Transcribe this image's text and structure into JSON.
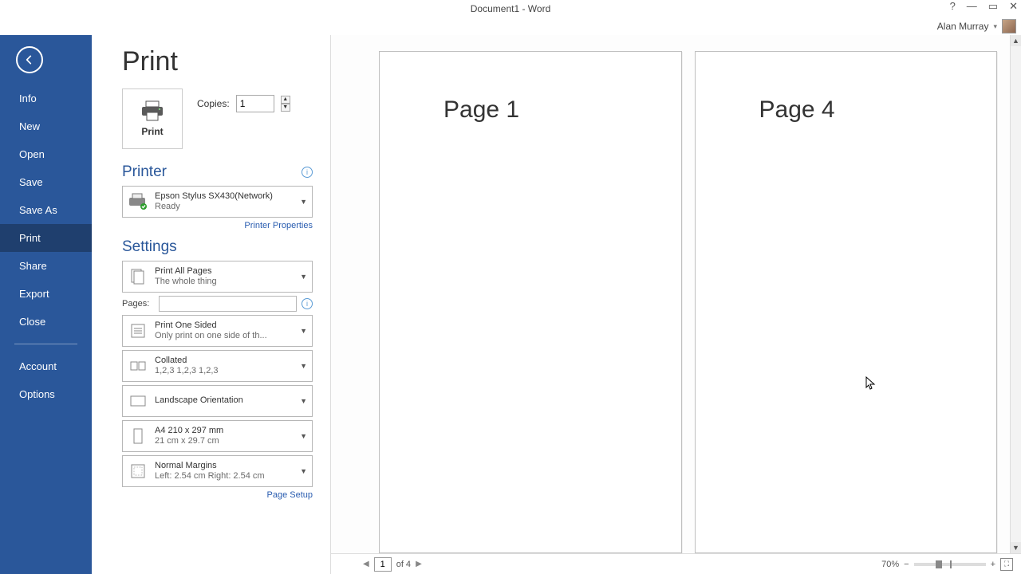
{
  "window": {
    "title": "Document1 - Word"
  },
  "user": {
    "name": "Alan Murray"
  },
  "nav": {
    "items": [
      "Info",
      "New",
      "Open",
      "Save",
      "Save As",
      "Print",
      "Share",
      "Export",
      "Close"
    ],
    "account": "Account",
    "options": "Options",
    "active_index": 5
  },
  "page": {
    "title": "Print",
    "print_button": "Print",
    "copies_label": "Copies:",
    "copies_value": "1"
  },
  "printer": {
    "heading": "Printer",
    "name": "Epson Stylus SX430(Network)",
    "status": "Ready",
    "properties_link": "Printer Properties"
  },
  "settings": {
    "heading": "Settings",
    "pages_row_label": "Pages:",
    "page_setup_link": "Page Setup",
    "items": [
      {
        "t1": "Print All Pages",
        "t2": "The whole thing"
      },
      {
        "t1": "Print One Sided",
        "t2": "Only print on one side of th..."
      },
      {
        "t1": "Collated",
        "t2": "1,2,3    1,2,3    1,2,3"
      },
      {
        "t1": "Landscape Orientation",
        "t2": ""
      },
      {
        "t1": "A4 210 x 297 mm",
        "t2": "21 cm x 29.7 cm"
      },
      {
        "t1": "Normal Margins",
        "t2": "Left:  2.54 cm    Right:  2.54 cm"
      }
    ]
  },
  "preview": {
    "pages": [
      "Page 1",
      "Page 4"
    ],
    "nav_current": "1",
    "nav_total": "of 4",
    "zoom": "70%"
  }
}
